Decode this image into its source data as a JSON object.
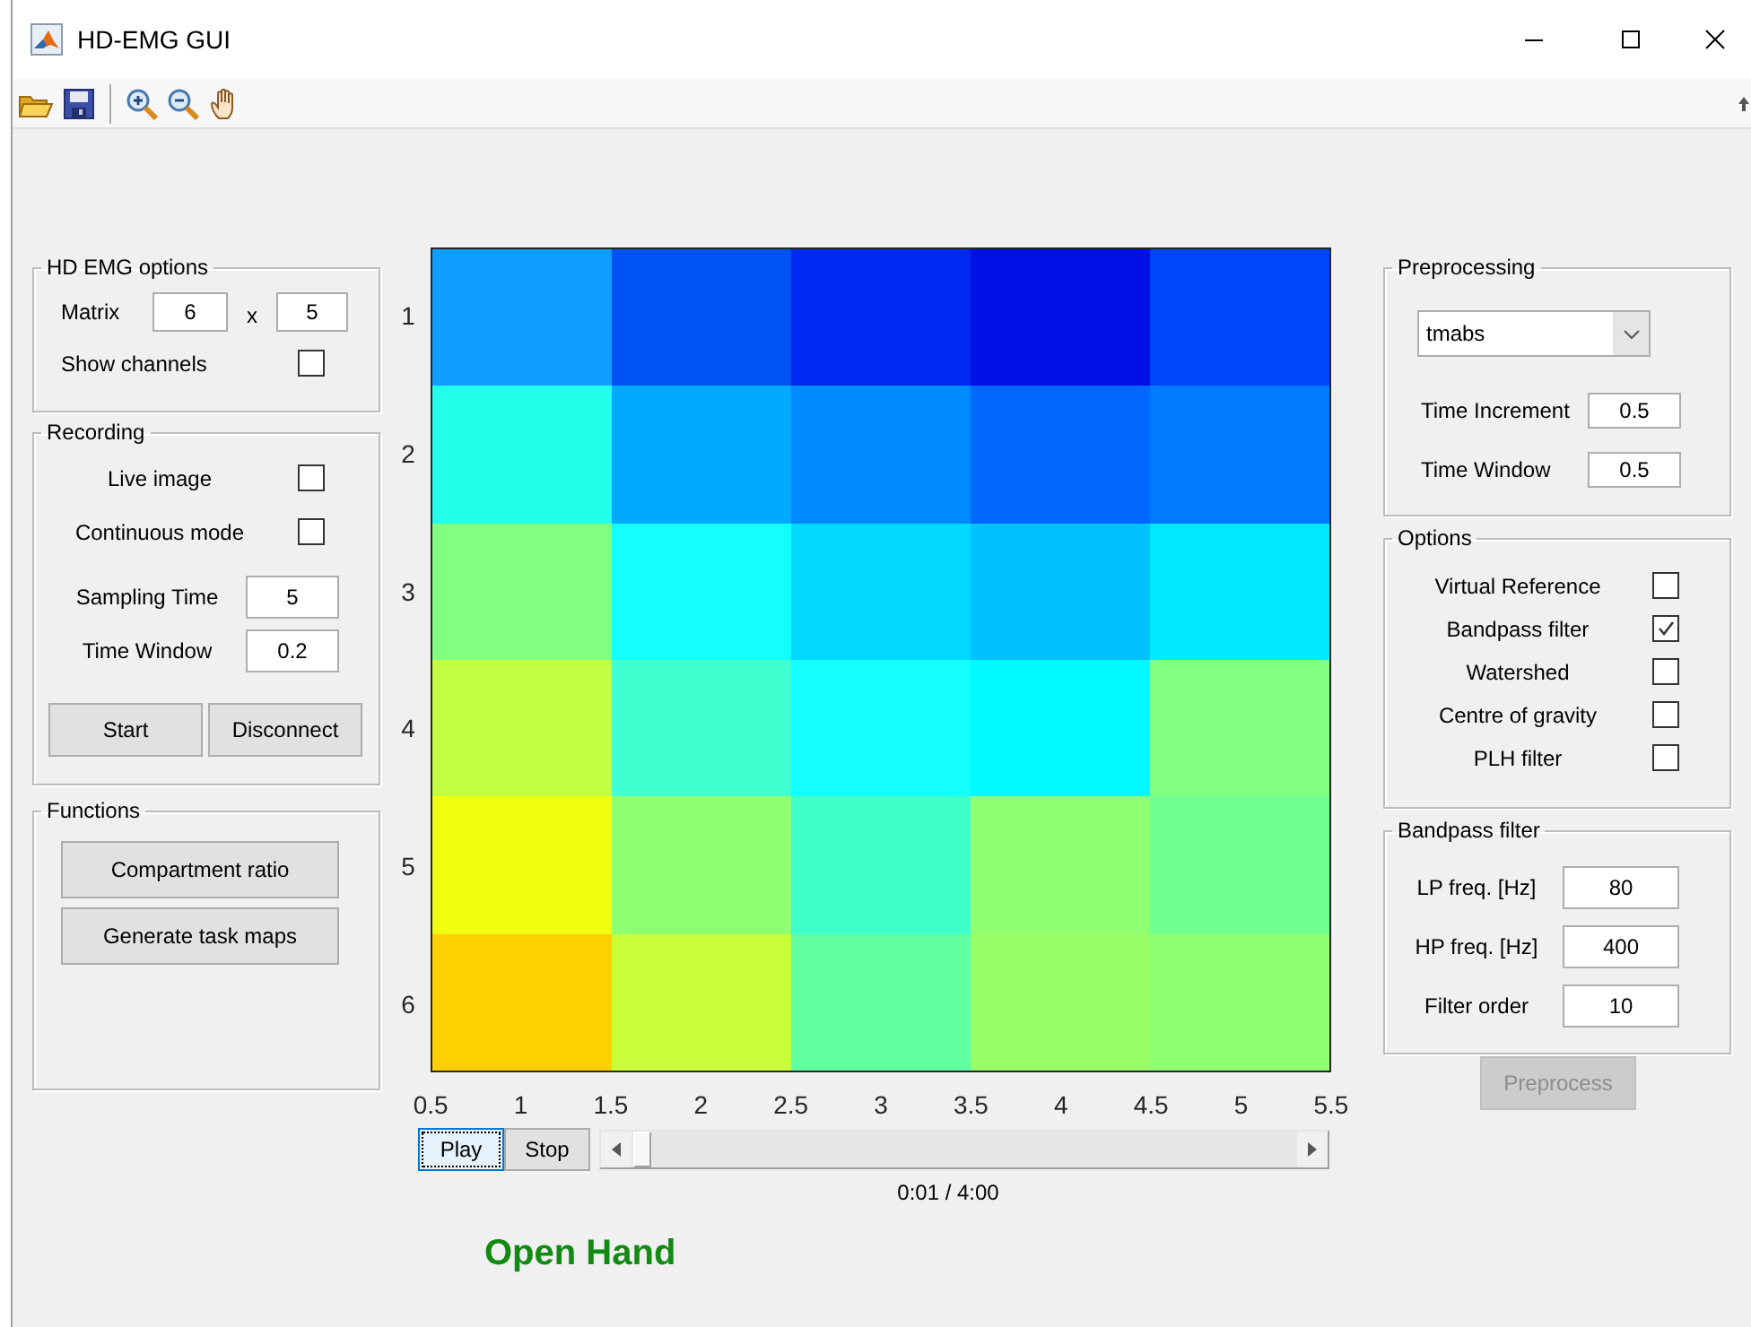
{
  "window": {
    "title": "HD-EMG GUI"
  },
  "hd_emg_options": {
    "title": "HD EMG options",
    "matrix_label": "Matrix",
    "matrix_rows": "6",
    "times": "x",
    "matrix_cols": "5",
    "show_channels": {
      "label": "Show channels",
      "checked": false
    }
  },
  "recording": {
    "title": "Recording",
    "checkboxes": [
      {
        "label": "Live image",
        "checked": false
      },
      {
        "label": "Continuous mode",
        "checked": false
      }
    ],
    "fields": [
      {
        "label": "Sampling Time",
        "value": "5"
      },
      {
        "label": "Time Window",
        "value": "0.2"
      }
    ],
    "buttons": [
      "Start",
      "Disconnect"
    ]
  },
  "functions": {
    "title": "Functions",
    "buttons": [
      "Compartment ratio",
      "Generate task maps"
    ]
  },
  "heatmap": {
    "yticks": [
      "1",
      "2",
      "3",
      "4",
      "5",
      "6"
    ],
    "xticks": [
      "0.5",
      "1",
      "1.5",
      "2",
      "2.5",
      "3",
      "3.5",
      "4",
      "4.5",
      "5",
      "5.5"
    ],
    "rows": [
      {
        "cells": [
          {
            "color": "#0e9eff"
          },
          {
            "color": "#0052f2"
          },
          {
            "color": "#0028f0"
          },
          {
            "color": "#0010e6"
          },
          {
            "color": "#0044fa"
          }
        ]
      },
      {
        "cells": [
          {
            "color": "#22ffea"
          },
          {
            "color": "#00aaff"
          },
          {
            "color": "#008aff"
          },
          {
            "color": "#0068ff"
          },
          {
            "color": "#007aff"
          }
        ]
      },
      {
        "cells": [
          {
            "color": "#80ff80"
          },
          {
            "color": "#12ffff"
          },
          {
            "color": "#00d8ff"
          },
          {
            "color": "#00c2ff"
          },
          {
            "color": "#00e8ff"
          }
        ]
      },
      {
        "cells": [
          {
            "color": "#c2ff40"
          },
          {
            "color": "#40ffd0"
          },
          {
            "color": "#12ffff"
          },
          {
            "color": "#00f8ff"
          },
          {
            "color": "#80ff80"
          }
        ]
      },
      {
        "cells": [
          {
            "color": "#f0ff10"
          },
          {
            "color": "#90ff70"
          },
          {
            "color": "#40ffc8"
          },
          {
            "color": "#90ff70"
          },
          {
            "color": "#70ff90"
          }
        ]
      },
      {
        "cells": [
          {
            "color": "#ffd000"
          },
          {
            "color": "#c8ff38"
          },
          {
            "color": "#60ffa0"
          },
          {
            "color": "#98ff68"
          },
          {
            "color": "#90ff70"
          }
        ]
      }
    ]
  },
  "player": {
    "buttons": [
      {
        "label": "Play",
        "focused": true
      },
      {
        "label": "Stop",
        "focused": false
      }
    ],
    "slider": {
      "level": 0.004
    },
    "time": "0:01 / 4:00"
  },
  "gesture": "Open Hand",
  "preprocessing": {
    "title": "Preprocessing",
    "method": "tmabs",
    "fields": [
      {
        "label": "Time Increment",
        "value": "0.5"
      },
      {
        "label": "Time Window",
        "value": "0.5"
      }
    ]
  },
  "options": {
    "title": "Options",
    "checkboxes": [
      {
        "label": "Virtual Reference",
        "checked": false
      },
      {
        "label": "Bandpass filter",
        "checked": true
      },
      {
        "label": "Watershed",
        "checked": false
      },
      {
        "label": "Centre of gravity",
        "checked": false
      },
      {
        "label": "PLH filter",
        "checked": false
      }
    ]
  },
  "bandpass_filter": {
    "title": "Bandpass filter",
    "fields": [
      {
        "label": "LP freq. [Hz]",
        "value": "80"
      },
      {
        "label": "HP freq. [Hz]",
        "value": "400"
      },
      {
        "label": "Filter order",
        "value": "10"
      }
    ]
  },
  "preprocess_button": {
    "label": "Preprocess",
    "disabled": true
  }
}
